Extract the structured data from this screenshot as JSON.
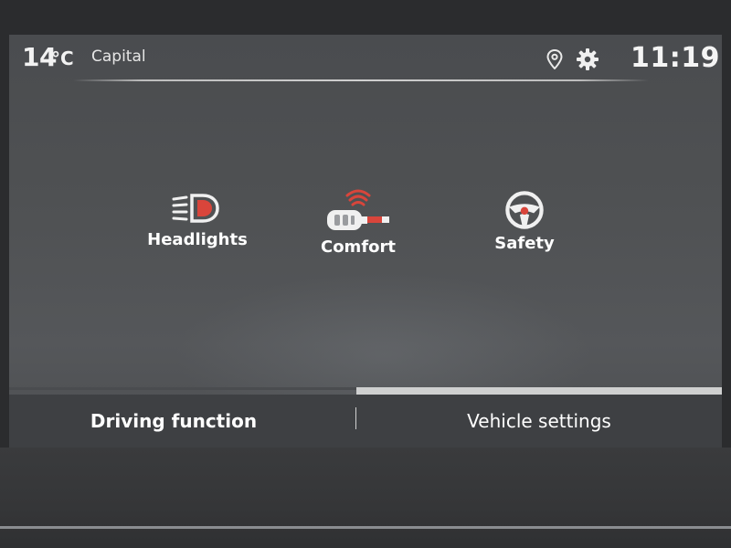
{
  "status": {
    "temperature": "14",
    "temperature_unit": "°C",
    "city": "Capital",
    "time": "11:19",
    "icons": [
      "location-icon",
      "gear-icon"
    ]
  },
  "tiles": [
    {
      "label": "Headlights",
      "icon": "headlights-icon"
    },
    {
      "label": "Comfort",
      "icon": "key-fob-wireless-icon"
    },
    {
      "label": "Safety",
      "icon": "steering-wheel-icon"
    }
  ],
  "tabs": [
    {
      "label": "Driving function",
      "selected": false
    },
    {
      "label": "Vehicle settings",
      "selected": true
    }
  ],
  "colors": {
    "accent": "#d9453b",
    "text": "#ffffff",
    "screen_bg": "#4f5153"
  }
}
